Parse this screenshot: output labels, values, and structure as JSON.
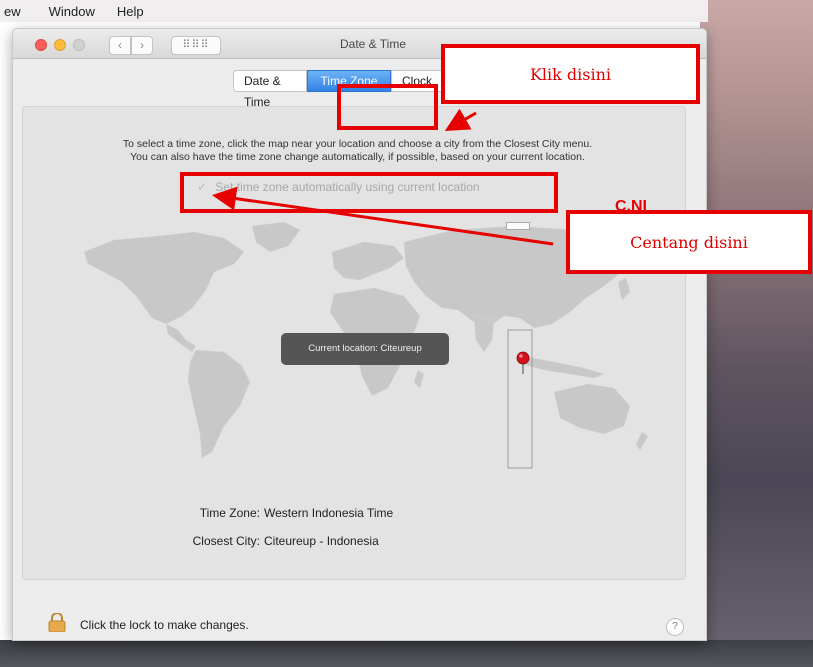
{
  "menubar": {
    "items": [
      "ew",
      "Window",
      "Help"
    ]
  },
  "window": {
    "title": "Date & Time",
    "grid_label": "⠿⠿⠿"
  },
  "tabs": [
    {
      "label": "Date & Time",
      "selected": false
    },
    {
      "label": "Time Zone",
      "selected": true
    },
    {
      "label": "Clock",
      "selected": false
    }
  ],
  "instructions": {
    "line1": "To select a time zone, click the map near your location and choose a city from the Closest City menu.",
    "line2": "You can also have the time zone change automatically, if possible, based on your current location."
  },
  "auto_setting": {
    "label": "Set time zone automatically using current location",
    "checked": true
  },
  "map": {
    "tooltip": "Current location: Citeureup"
  },
  "info": {
    "time_zone_label": "Time Zone:",
    "time_zone_value": "Western Indonesia Time",
    "closest_city_label": "Closest City:",
    "closest_city_value": "Citeureup - Indonesia"
  },
  "footer": {
    "lock_text": "Click the lock to make changes.",
    "help": "?"
  },
  "annotations": {
    "klik": "Klik disini",
    "centang": "Centang disini",
    "partial": "C.NI"
  },
  "colors": {
    "annotation": "#e60000",
    "selected_tab": "#3384e7",
    "panel": "#e3e3e3",
    "map_land": "#c8c8c8"
  }
}
